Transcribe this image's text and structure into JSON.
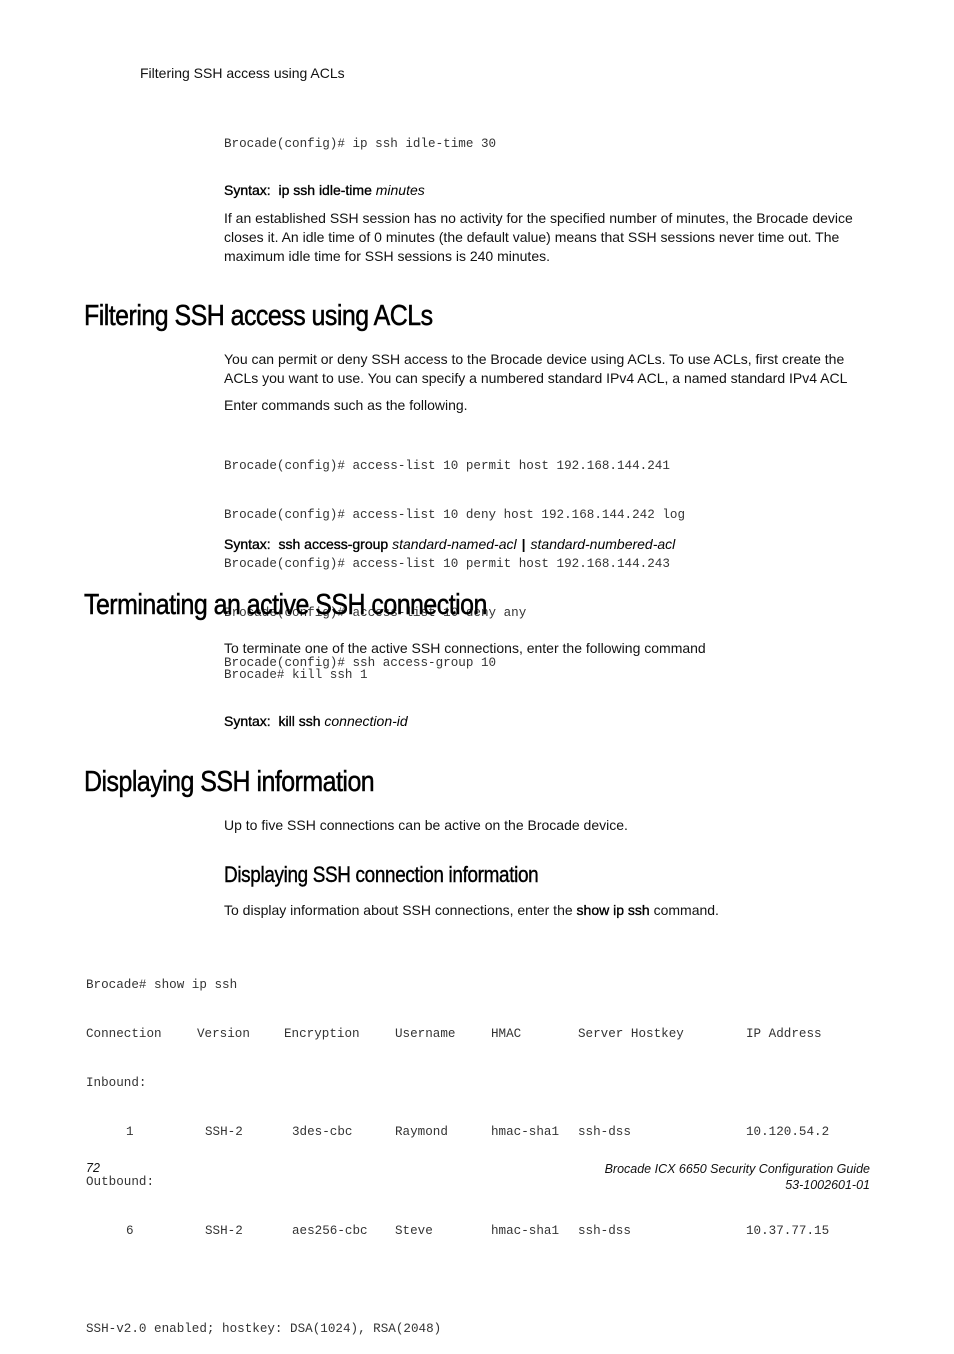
{
  "running_header": "Filtering SSH access using ACLs",
  "idle_time": {
    "code": [
      "Brocade(config)# ip ssh idle-time 30"
    ],
    "syntax": {
      "label": "Syntax:",
      "command": "ip ssh idle-time",
      "argument": "minutes"
    },
    "description": "If an established SSH session has no activity for the specified number of minutes, the Brocade device closes it. An idle time of 0 minutes (the default value) means that SSH sessions never time out. The maximum idle time for SSH sessions is 240 minutes."
  },
  "section_filtering": {
    "heading": "Filtering SSH access using ACLs",
    "paragraph1_line1": "You can permit or deny SSH access to the Brocade device using ACLs. To use ACLs, first create the",
    "paragraph1_line2": "ACLs you want to use. You can specify a numbered standard IPv4 ACL, a named standard IPv4 ACL",
    "paragraph2": "Enter commands such as the following.",
    "code": [
      "Brocade(config)# access-list 10 permit host 192.168.144.241",
      "Brocade(config)# access-list 10 deny host 192.168.144.242 log",
      "Brocade(config)# access-list 10 permit host 192.168.144.243",
      "Brocade(config)# access-list 10 deny any",
      "Brocade(config)# ssh access-group 10"
    ],
    "syntax": {
      "label": "Syntax:",
      "command": "ssh access-group",
      "argument1": "standard-named-acl",
      "separator": "|",
      "argument2": "standard-numbered-acl"
    }
  },
  "section_terminating": {
    "heading": "Terminating an active SSH connection",
    "paragraph": "To terminate one of the active SSH connections, enter the following command",
    "code": [
      "Brocade# kill ssh 1"
    ],
    "syntax": {
      "label": "Syntax:",
      "command": "kill ssh",
      "argument": "connection-id"
    }
  },
  "section_displaying": {
    "heading": "Displaying SSH information",
    "paragraph": "Up to five SSH connections can be active on the Brocade device.",
    "subsection": {
      "heading": "Displaying SSH connection information",
      "paragraph_before": "To display information about SSH connections, enter the ",
      "paragraph_command": "show ip ssh",
      "paragraph_after": " command.",
      "output": {
        "prompt_line": "Brocade# show ip ssh",
        "columns": [
          "Connection",
          "Version",
          "Encryption",
          "Username",
          "HMAC",
          "Server Hostkey",
          "IP Address"
        ],
        "groups": [
          {
            "label": "Inbound:",
            "rows": [
              [
                "1",
                "SSH-2",
                "3des-cbc",
                "Raymond",
                "hmac-sha1",
                "ssh-dss",
                "10.120.54.2"
              ]
            ]
          },
          {
            "label": "Outbound:",
            "rows": [
              [
                "6",
                "SSH-2",
                "aes256-cbc",
                "Steve",
                "hmac-sha1",
                "ssh-dss",
                "10.37.77.15"
              ]
            ]
          }
        ],
        "status_line": "SSH-v2.0 enabled; hostkey: DSA(1024), RSA(2048)"
      }
    }
  },
  "footer": {
    "page_number": "72",
    "doc_title": "Brocade ICX 6650 Security Configuration Guide",
    "doc_number": "53-1002601-01"
  }
}
